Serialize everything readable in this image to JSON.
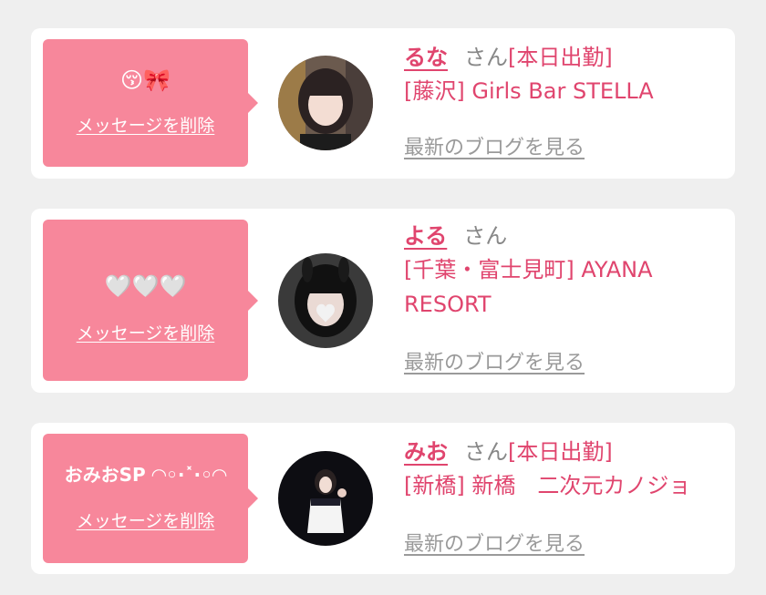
{
  "entries": [
    {
      "message": "😚🎀",
      "delete_label": "メッセージを削除",
      "name": "るな",
      "honorific": "さん",
      "status": "[本日出勤]",
      "shop": "[藤沢] Girls Bar STELLA",
      "blog_label": "最新のブログを見る"
    },
    {
      "message": "🤍🤍🤍",
      "delete_label": "メッセージを削除",
      "name": "よる",
      "honorific": "さん",
      "status": "",
      "shop": "[千葉・富士見町] AYANA RESORT",
      "blog_label": "最新のブログを見る"
    },
    {
      "message": "おみおSP ◜◝◦·˟·◦◜◝",
      "delete_label": "メッセージを削除",
      "name": "みお",
      "honorific": "さん",
      "status": "[本日出勤]",
      "shop": "[新橋] 新橋　二次元カノジョ",
      "blog_label": "最新のブログを見る"
    }
  ],
  "colors": {
    "background": "#efefef",
    "card": "#ffffff",
    "bubble": "#f7879b",
    "accent": "#e0456e",
    "muted": "#888888",
    "link_gray": "#9a9a9a"
  }
}
